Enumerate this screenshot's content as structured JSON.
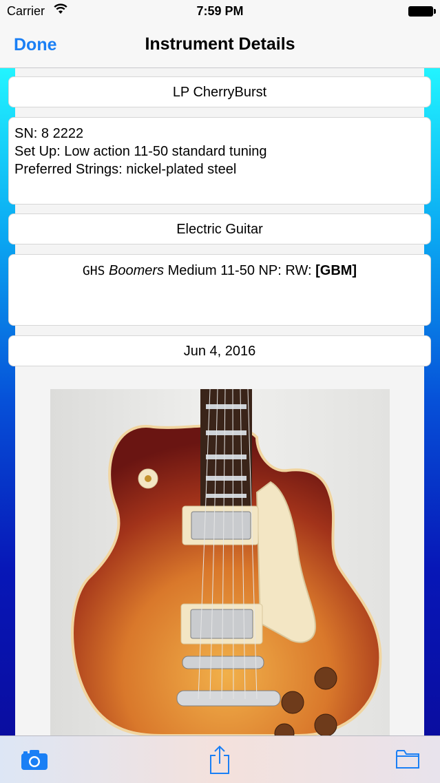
{
  "status_bar": {
    "carrier": "Carrier",
    "time": "7:59 PM"
  },
  "nav": {
    "done_label": "Done",
    "title": "Instrument Details"
  },
  "instrument": {
    "name": "LP CherryBurst",
    "notes": [
      "SN: 8 2222",
      "Set Up: Low action 11-50 standard tuning",
      "Preferred Strings: nickel-plated steel"
    ],
    "type": "Electric Guitar",
    "strings": {
      "brand": "GHS",
      "model": "Boomers",
      "spec": "Medium 11-50 NP: RW:",
      "code": "[GBM]"
    },
    "date": "Jun 4, 2016"
  },
  "toolbar": {
    "camera_icon": "camera-icon",
    "share_icon": "share-icon",
    "folder_icon": "folder-icon"
  },
  "colors": {
    "accent": "#1a7ff5",
    "gradient_top": "#22f4ff",
    "gradient_bottom": "#0a0da0"
  }
}
